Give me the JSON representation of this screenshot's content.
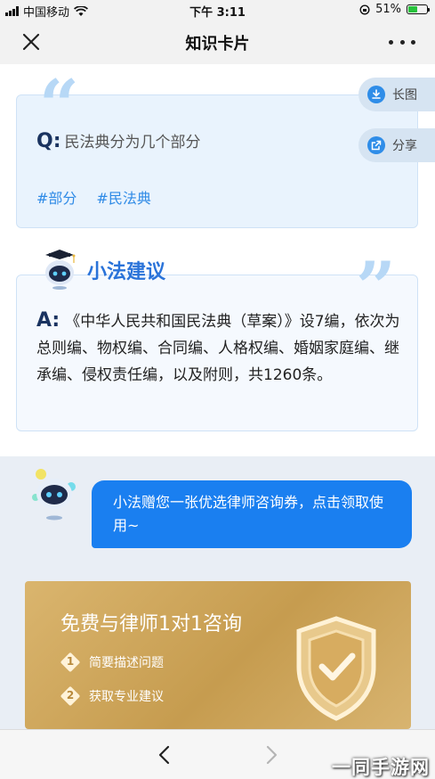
{
  "status_bar": {
    "carrier": "中国移动",
    "time": "下午 3:11",
    "battery_percent": "51%",
    "battery_level": 0.51
  },
  "nav": {
    "title": "知识卡片",
    "close_icon": "close-icon",
    "more_icon": "more-icon"
  },
  "side_buttons": {
    "long_image": "长图",
    "share": "分享"
  },
  "question": {
    "label": "Q:",
    "text": "民法典分为几个部分",
    "tags": [
      "#部分",
      "#民法典"
    ]
  },
  "advice": {
    "title": "小法建议",
    "answer_label": "A:",
    "answer_text": "《中华人民共和国民法典（草案）》设7编，依次为总则编、物权编、合同编、人格权编、婚姻家庭编、继承编、侵权责任编，以及附则，共1260条。"
  },
  "chat": {
    "bubble_text": "小法赠您一张优选律师咨询券，点击领取使用~"
  },
  "consult_card": {
    "title": "免费与律师1对1咨询",
    "steps": [
      {
        "num": "1",
        "text": "简要描述问题"
      },
      {
        "num": "2",
        "text": "获取专业建议"
      }
    ]
  },
  "toolbar": {
    "back_icon": "chevron-left-icon",
    "forward_icon": "chevron-right-icon"
  },
  "watermark": "一同手游网",
  "colors": {
    "accent": "#1a7ff0",
    "brand_blue": "#2a73d9",
    "gold": "#c69c4f"
  }
}
